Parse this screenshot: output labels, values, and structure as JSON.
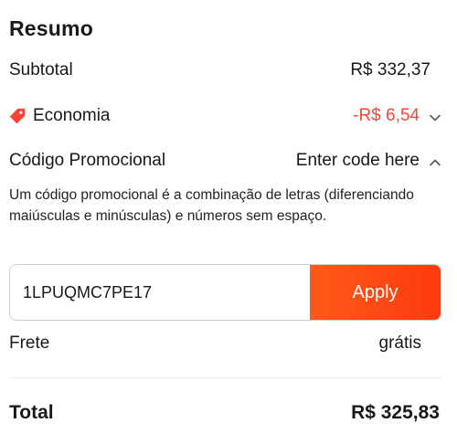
{
  "summary": {
    "title": "Resumo",
    "subtotal_label": "Subtotal",
    "subtotal_value": "R$ 332,37",
    "savings_label": "Economia",
    "savings_value": "-R$ 6,54",
    "promo_label": "Código Promocional",
    "promo_toggle": "Enter code here",
    "promo_description": "Um código promocional é a combinação de letras (diferenciando maiúsculas e minúsculas) e números sem espaço.",
    "promo_code_value": "1LPUQMC7PE17",
    "apply_label": "Apply",
    "shipping_label": "Frete",
    "shipping_value": "grátis",
    "total_label": "Total",
    "total_value": "R$ 325,83"
  },
  "colors": {
    "accent": "#ff4433",
    "apply_button": "#ff4a14"
  },
  "icons": {
    "savings": "tag-icon",
    "savings_toggle": "chevron-down-icon",
    "promo_toggle": "chevron-up-icon"
  }
}
